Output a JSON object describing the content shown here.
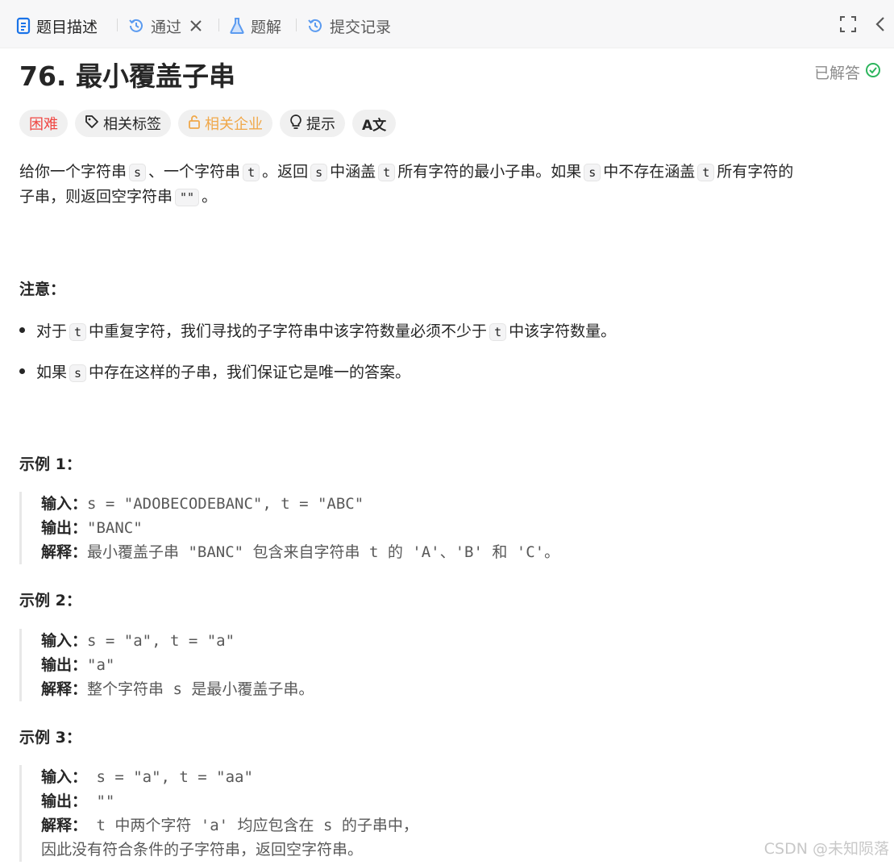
{
  "tabs": [
    {
      "label": "题目描述",
      "icon": "document-icon",
      "color": "#1a73e8"
    },
    {
      "label": "通过",
      "icon": "history-icon",
      "color": "#1a73e8"
    },
    {
      "label": "题解",
      "icon": "flask-icon",
      "color": "#1a73e8"
    },
    {
      "label": "提交记录",
      "icon": "history-icon",
      "color": "#1a73e8"
    }
  ],
  "problem": {
    "title": "76. 最小覆盖子串",
    "status": "已解答"
  },
  "tags": {
    "difficulty": "困难",
    "related_tags": "相关标签",
    "companies": "相关企业",
    "hint": "提示",
    "translate": "A文"
  },
  "description": {
    "p1": "给你一个字符串",
    "c1": "s",
    "p2": "、一个字符串",
    "c2": "t",
    "p3": "。返回",
    "c3": "s",
    "p4": "中涵盖",
    "c4": "t",
    "p5": "所有字符的最小子串。如果",
    "c5": "s",
    "p6": "中不存在涵盖",
    "c6": "t",
    "p7": "所有字符的",
    "p8": "子串，则返回空字符串",
    "c7": "\"\"",
    "p9": "。"
  },
  "notes": {
    "heading": "注意：",
    "b1_a": "对于",
    "b1_c1": "t",
    "b1_b": "中重复字符，我们寻找的子字符串中该字符数量必须不少于",
    "b1_c2": "t",
    "b1_c": "中该字符数量。",
    "b2_a": "如果",
    "b2_c1": "s",
    "b2_b": "中存在这样的子串，我们保证它是唯一的答案。"
  },
  "examples": [
    {
      "heading": "示例 1：",
      "input_label": "输入：",
      "input": "s = \"ADOBECODEBANC\", t = \"ABC\"",
      "output_label": "输出：",
      "output": "\"BANC\"",
      "explain_label": "解释：",
      "explain": "最小覆盖子串 \"BANC\" 包含来自字符串 t 的 'A'、'B' 和 'C'。"
    },
    {
      "heading": "示例 2：",
      "input_label": "输入：",
      "input": "s = \"a\", t = \"a\"",
      "output_label": "输出：",
      "output": "\"a\"",
      "explain_label": "解释：",
      "explain": "整个字符串 s 是最小覆盖子串。"
    },
    {
      "heading": "示例 3：",
      "input_label": "输入：",
      "input": " s = \"a\", t = \"aa\"",
      "output_label": "输出：",
      "output": " \"\"",
      "explain_label": "解释：",
      "explain": " t 中两个字符 'a' 均应包含在 s 的子串中，",
      "explain2": "因此没有符合条件的子字符串，返回空字符串。"
    }
  ],
  "watermark": "CSDN @未知陨落",
  "colors": {
    "accent": "#1a73e8",
    "hard": "#ef4743",
    "company": "#f0a84a",
    "solved": "#2db55d"
  }
}
